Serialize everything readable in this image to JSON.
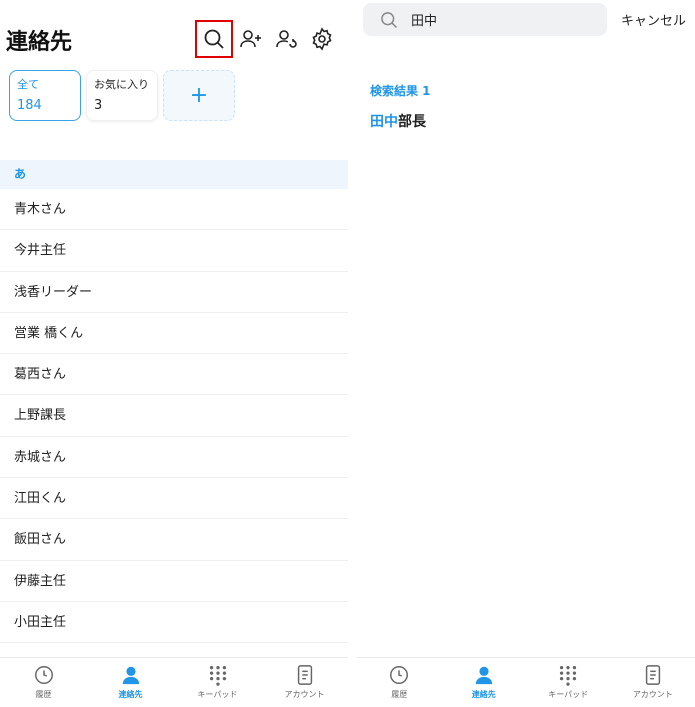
{
  "left": {
    "title": "連絡先",
    "header_icons": [
      "search-icon",
      "add-user-icon",
      "sync-user-icon",
      "gear-icon"
    ],
    "cards": {
      "all": {
        "label": "全て",
        "count": "184"
      },
      "favorites": {
        "label": "お気に入り",
        "count": "3"
      },
      "add": {
        "label": "+"
      }
    },
    "section": "あ",
    "contacts": [
      "青木さん",
      "今井主任",
      "浅香リーダー",
      "営業 橋くん",
      "葛西さん",
      "上野課長",
      "赤城さん",
      "江田くん",
      "飯田さん",
      "伊藤主任",
      "小田主任"
    ]
  },
  "right": {
    "search": {
      "value": "田中",
      "placeholder": ""
    },
    "cancel": "キャンセル",
    "result_count": "検索結果 1",
    "result": {
      "highlight": "田中",
      "rest": "部長"
    }
  },
  "nav": {
    "history": "履歴",
    "contacts": "連絡先",
    "keypad": "キーパッド",
    "account": "アカウント"
  },
  "colors": {
    "accent": "#2196e6",
    "highlight_box": "#e00000"
  }
}
